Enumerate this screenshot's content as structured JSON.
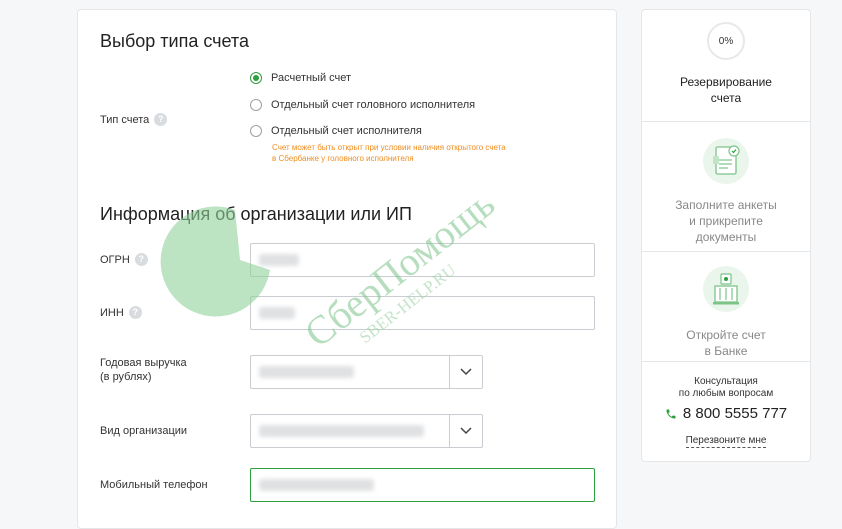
{
  "account_section": {
    "title": "Выбор типа счета",
    "type_label": "Тип счета",
    "options": [
      {
        "label": "Расчетный счет",
        "checked": true
      },
      {
        "label": "Отдельный счет головного исполнителя",
        "checked": false
      },
      {
        "label": "Отдельный счет исполнителя",
        "checked": false
      }
    ],
    "hint_line1": "Счет может быть открыт при условии наличия открытого счета",
    "hint_line2": "в Сбербанке у головного исполнителя"
  },
  "org_section": {
    "title": "Информация об организации или ИП",
    "ogrn_label": "ОГРН",
    "inn_label": "ИНН",
    "revenue_label_line1": "Годовая выручка",
    "revenue_label_line2": "(в рублях)",
    "org_type_label": "Вид организации",
    "phone_label": "Мобильный телефон"
  },
  "sidebar": {
    "progress_text": "0%",
    "progress_value": 0,
    "step1_line1": "Резервирование",
    "step1_line2": "счета",
    "step2_line1": "Заполните анкеты",
    "step2_line2": "и прикрепите",
    "step2_line3": "документы",
    "step3_line1": "Откройте счет",
    "step3_line2": "в Банке",
    "consult_line1": "Консультация",
    "consult_line2": "по любым вопросам",
    "phone": "8 800 5555 777",
    "callback": "Перезвоните мне"
  },
  "watermark": {
    "line1": "СберПомощь",
    "line2": "SBER-HELP.RU"
  },
  "colors": {
    "accent": "#2e9e3e",
    "hint": "#f08c1e",
    "border": "#c9cdd1"
  }
}
